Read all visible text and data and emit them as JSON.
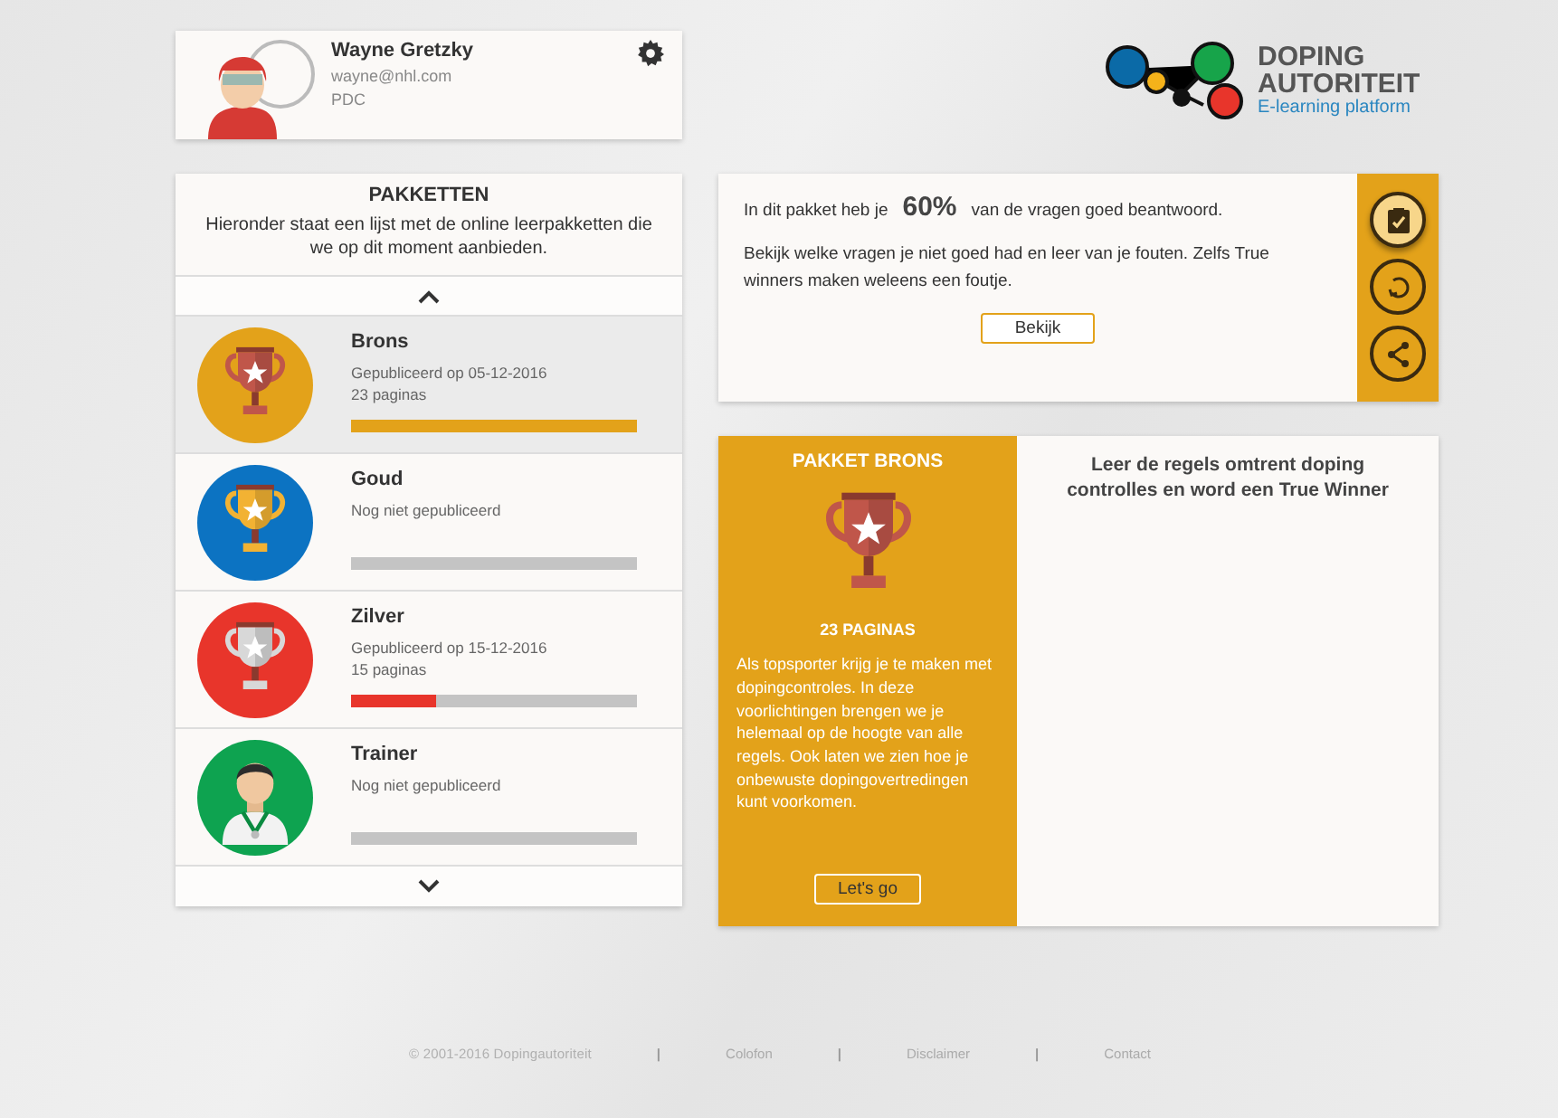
{
  "profile": {
    "name": "Wayne Gretzky",
    "email": "wayne@nhl.com",
    "role": "PDC"
  },
  "logo": {
    "title": "DOPING AUTORITEIT",
    "subtitle": "E-learning platform"
  },
  "packages": {
    "title": "PAKKETTEN",
    "description": "Hieronder staat een lijst met de online leerpakketten die we op dit moment aanbieden.",
    "items": [
      {
        "name": "Brons",
        "status": "Gepubliceerd op 05-12-2016",
        "pages": "23 paginas",
        "level": 1,
        "color": "#e3a21a",
        "kind": "bronze",
        "selected": true
      },
      {
        "name": "Goud",
        "status": "Nog niet gepubliceerd",
        "level": 0,
        "color": "#0c73c2",
        "kind": "gold",
        "selected": false
      },
      {
        "name": "Zilver",
        "status": "Gepubliceerd op 15-12-2016",
        "pages": "15 paginas",
        "level": 0.3,
        "color": "#e8352b",
        "kind": "silver",
        "selected": false
      },
      {
        "name": "Trainer",
        "status": "Nog niet gepubliceerd",
        "level": 0,
        "color": "#0ea350",
        "kind": "person",
        "selected": false
      }
    ]
  },
  "result": {
    "before": "In dit pakket heb je",
    "score": "60%",
    "after": "van de vragen goed beantwoord.",
    "advice": "Bekijk welke vragen je niet goed had en leer van je fouten. Zelfs True winners maken weleens een foutje.",
    "button": "Bekijk",
    "actions": [
      {
        "kind": "clipboard",
        "selected": true
      },
      {
        "kind": "retry",
        "selected": false
      },
      {
        "kind": "share",
        "selected": false
      }
    ]
  },
  "package_detail": {
    "title": "PAKKET BRONS",
    "pages": "23 PAGINAS",
    "description": "Als topsporter krijg je te maken met dopingcontroles. In deze voorlichtingen brengen we je helemaal op de hoogte van alle regels. Ook laten we zien hoe je onbewuste dopingovertredingen kunt voorkomen.",
    "button": "Let's go",
    "tagline": "Leer de regels omtrent doping controlles en word een True Winner"
  },
  "footer": [
    {
      "kind": "text",
      "text": "© 2001-2016 Dopingautoriteit"
    },
    {
      "kind": "separator",
      "text": "|"
    },
    {
      "kind": "link",
      "text": "Colofon"
    },
    {
      "kind": "separator",
      "text": "|"
    },
    {
      "kind": "link",
      "text": "Disclaimer"
    },
    {
      "kind": "separator",
      "text": "|"
    },
    {
      "kind": "link",
      "text": "Contact"
    }
  ]
}
